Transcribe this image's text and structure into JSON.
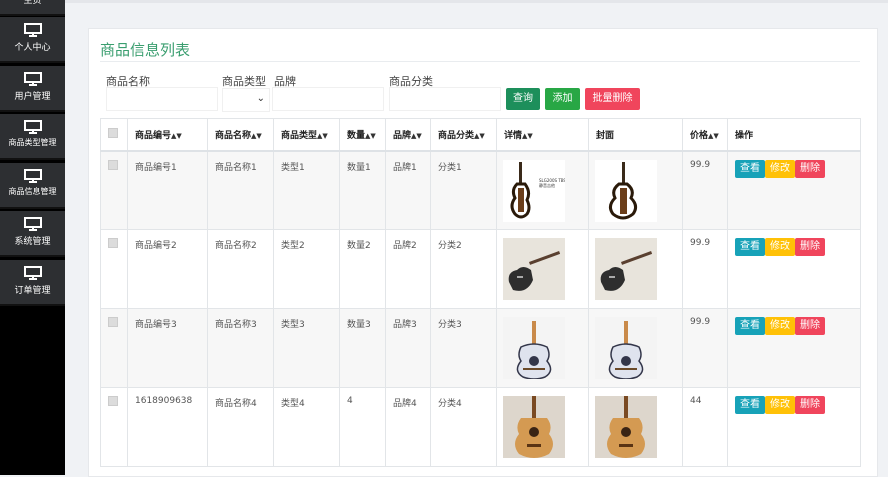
{
  "sidebar": {
    "items": [
      {
        "label": "主页"
      },
      {
        "label": "个人中心"
      },
      {
        "label": "用户管理"
      },
      {
        "label": "商品类型管理"
      },
      {
        "label": "商品信息管理"
      },
      {
        "label": "系统管理"
      },
      {
        "label": "订单管理"
      }
    ]
  },
  "page": {
    "title": "商品信息列表"
  },
  "filters": {
    "name_label": "商品名称",
    "type_label": "商品类型",
    "brand_label": "品牌",
    "category_label": "商品分类",
    "name_value": "",
    "brand_value": "",
    "category_value": "",
    "search_button": "查询",
    "add_button": "添加",
    "batch_delete_button": "批量删除"
  },
  "table": {
    "headers": [
      "商品编号",
      "商品名称",
      "商品类型",
      "数量",
      "品牌",
      "商品分类",
      "详情",
      "封面",
      "价格",
      "操作"
    ],
    "rows": [
      {
        "code": "商品编号1",
        "name": "商品名称1",
        "type": "类型1",
        "qty": "数量1",
        "brand": "品牌1",
        "category": "分类1",
        "price": "99.9",
        "image": "silent-guitar"
      },
      {
        "code": "商品编号2",
        "name": "商品名称2",
        "type": "类型2",
        "qty": "数量2",
        "brand": "品牌2",
        "category": "分类2",
        "price": "99.9",
        "image": "dark-electric-guitar"
      },
      {
        "code": "商品编号3",
        "name": "商品名称3",
        "type": "类型3",
        "qty": "数量3",
        "brand": "品牌3",
        "category": "分类3",
        "price": "99.9",
        "image": "decorated-guitar"
      },
      {
        "code": "1618909638",
        "name": "商品名称4",
        "type": "类型4",
        "qty": "4",
        "brand": "品牌4",
        "category": "分类4",
        "price": "44",
        "image": "acoustic-guitar"
      }
    ],
    "actions": {
      "view": "查看",
      "edit": "修改",
      "delete": "删除"
    }
  },
  "colors": {
    "title": "#3a9e6f",
    "search": "#1d8f5b",
    "add": "#28a745",
    "batch_delete": "#f0455c",
    "view": "#17a2b8",
    "edit": "#ffc107",
    "delete": "#f0455c",
    "sidebar_item": "#2d2f32"
  }
}
